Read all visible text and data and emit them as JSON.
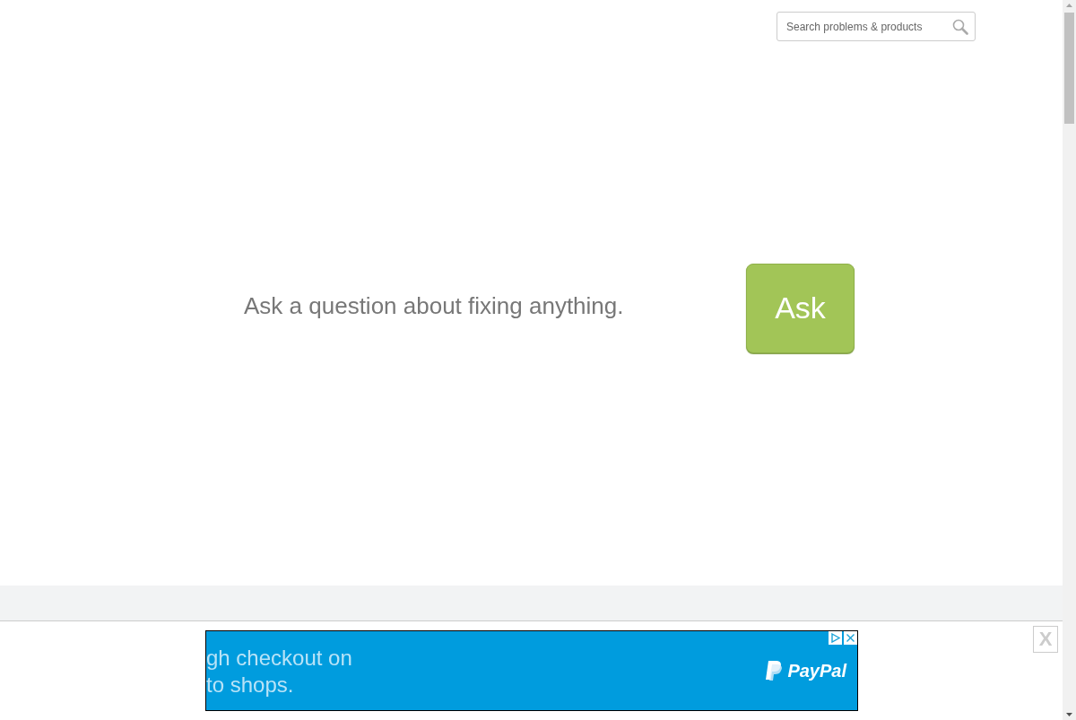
{
  "header": {
    "search": {
      "placeholder": "Search problems & products"
    }
  },
  "hero": {
    "prompt": "Ask a question about fixing anything.",
    "ask_button": "Ask"
  },
  "ad_bar": {
    "lines": [
      "gh checkout on",
      "to shops."
    ],
    "brand": "PayPal",
    "close_button": "X"
  }
}
